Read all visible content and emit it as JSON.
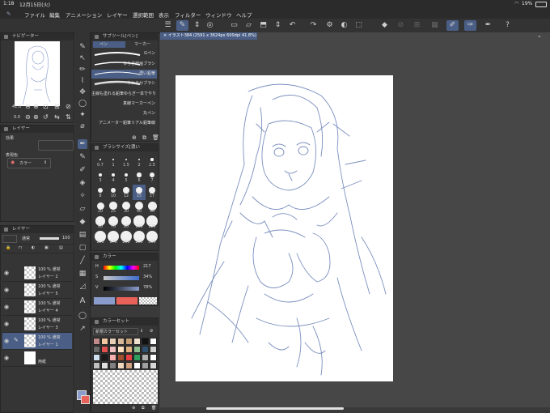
{
  "status": {
    "time": "1:18",
    "date": "12月15日(火)",
    "battery": "19%"
  },
  "menu": [
    "ファイル",
    "編集",
    "アニメーション",
    "レイヤー",
    "選択範囲",
    "表示",
    "フィルター",
    "ウィンドウ",
    "ヘルプ"
  ],
  "canvas_tab": "イラスト384 (2591 x 3624px 600dpi 41.8%)",
  "navigator": {
    "title": "ナビゲーター",
    "zoom": "41.8",
    "rotation": "0.0"
  },
  "layer_property": {
    "title": "レイヤー",
    "effect_label": "効果",
    "color_label": "表現色",
    "color_value": "カラー"
  },
  "layers_panel": {
    "title": "レイヤー",
    "blend": "通常",
    "opacity": "100"
  },
  "layers": [
    {
      "opacity": "100 %",
      "blend": "通常",
      "name": "レイヤー 2",
      "selected": false
    },
    {
      "opacity": "100 %",
      "blend": "通常",
      "name": "レイヤー 5",
      "selected": false
    },
    {
      "opacity": "100 %",
      "blend": "通常",
      "name": "レイヤー 4",
      "selected": false
    },
    {
      "opacity": "100 %",
      "blend": "通常",
      "name": "レイヤー 3",
      "selected": false
    },
    {
      "opacity": "100 %",
      "blend": "通常",
      "name": "レイヤー 1",
      "selected": true
    },
    {
      "opacity": "",
      "blend": "",
      "name": "用紙",
      "selected": false
    }
  ],
  "subtool": {
    "title": "サブツール[ペン]",
    "tabs": [
      "ペン",
      "マーカー"
    ]
  },
  "brushes": [
    "Gペン",
    "ゆらぎ線画ブラシ",
    "濃い鉛筆",
    "やわらかブラシ",
    "主線も塗れる鉛筆ゆらぎ一本でやり",
    "真線マーカーペン",
    "丸ペン",
    "アニメーター鉛筆リアル鉛筆線"
  ],
  "brush_size": {
    "title": "ブラシサイズ[濃い",
    "rows": [
      [
        "0.7",
        "1",
        "1.5",
        "2",
        "2.5"
      ],
      [
        "3",
        "4",
        "5",
        "6",
        "7"
      ],
      [
        "8",
        "10",
        "12",
        "15",
        "17"
      ],
      [
        "20",
        "25",
        "30",
        "40",
        "50"
      ],
      [
        "60",
        "70",
        "80",
        "100",
        "120"
      ],
      [
        "150",
        "170",
        "200",
        "250",
        "300"
      ]
    ],
    "selected": "15"
  },
  "color_slider": {
    "title": "カラー",
    "h": "217",
    "s": "34%",
    "v": "78%",
    "h_label": "H",
    "s_label": "S",
    "v_label": "V",
    "main_color": "#8a9ccc",
    "sub_color": "#e8625a"
  },
  "color_set": {
    "title": "カラーセット",
    "name": "新規カラーセット"
  },
  "swatch_colors": [
    "#c08a8a",
    "#f2c6a0",
    "#e8d0b8",
    "#d8b89a",
    "#c8a078",
    "#f0e0d0",
    "#111111",
    "#ffffff",
    "#6a6a6a",
    "#e45050",
    "#f0c0c0",
    "#ffe0c0",
    "#e0b080",
    "#90c090",
    "#305070",
    "#d0d0d0",
    "#cfe0f0",
    "#1a1a1a",
    "#f8b0b0",
    "#a05030",
    "#e84040",
    "#30a060",
    "#b0b0b0",
    "#ffffff",
    "#c0c0c0",
    "#e0e0e0",
    "#808080",
    "#f0d8c0",
    "#d0a080",
    "#ffffff",
    "#a0a0a0",
    "#d8d8d8"
  ]
}
